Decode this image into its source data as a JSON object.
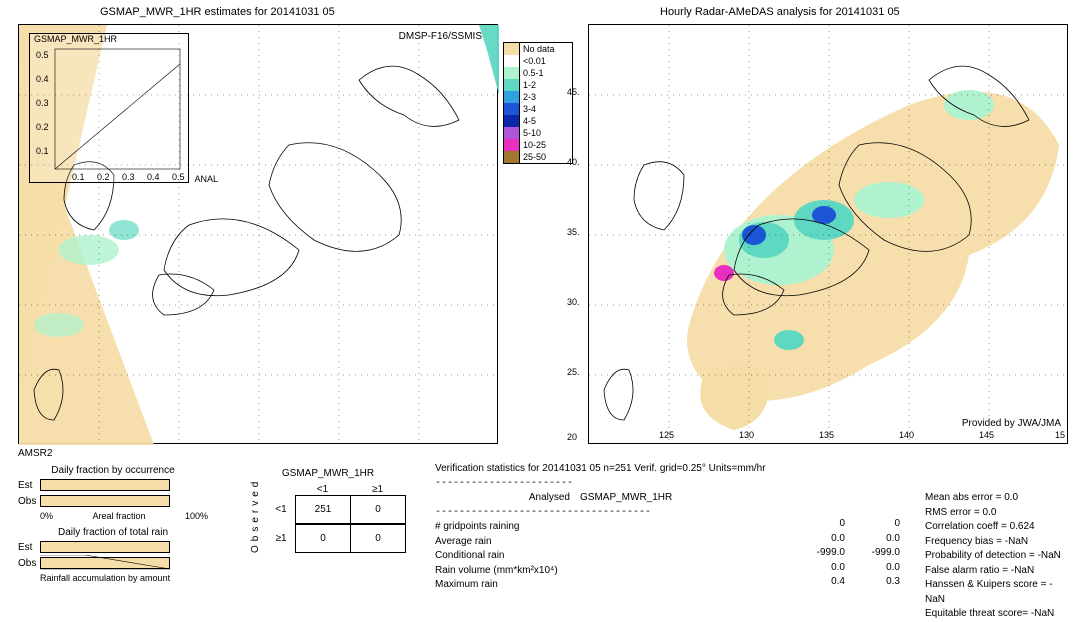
{
  "chart_data": [
    {
      "type": "map",
      "title": "GSMAP_MWR_1HR estimates for 20141031 05",
      "xlim": [
        120,
        150
      ],
      "ylim": [
        20,
        50
      ],
      "overlays": [
        "AMSR2",
        "DMSP-F16/SSMIS"
      ],
      "legend": [
        {
          "label": "No data",
          "color": "#f5dda8"
        },
        {
          "label": "<0.01",
          "color": "#ffffff"
        },
        {
          "label": "0.5-1",
          "color": "#aef2d0"
        },
        {
          "label": "1-2",
          "color": "#5fd8c2"
        },
        {
          "label": "2-3",
          "color": "#2fa0e0"
        },
        {
          "label": "3-4",
          "color": "#1c56d6"
        },
        {
          "label": "4-5",
          "color": "#0a28a8"
        },
        {
          "label": "5-10",
          "color": "#b055d8"
        },
        {
          "label": "10-25",
          "color": "#e82fc0"
        },
        {
          "label": "25-50",
          "color": "#a07830"
        }
      ],
      "inset": {
        "label": "GSMAP_MWR_1HR",
        "xlim": [
          0.0,
          0.5
        ],
        "ylim": [
          0.0,
          0.5
        ],
        "xticks": [
          0.1,
          0.2,
          0.3,
          0.4,
          0.5
        ],
        "yticks": [
          0.1,
          0.2,
          0.3,
          0.4,
          0.5
        ],
        "diag_label": "ANAL"
      }
    },
    {
      "type": "map",
      "title": "Hourly Radar-AMeDAS analysis for 20141031 05",
      "xlim": [
        120,
        150
      ],
      "ylim": [
        20,
        50
      ],
      "xticks": [
        125,
        130,
        135,
        140,
        145
      ],
      "yticks": [
        25,
        30,
        35,
        40,
        45
      ],
      "provider": "Provided by JWA/JMA"
    },
    {
      "type": "bar",
      "title": "Daily fraction by occurrence",
      "categories": [
        "Est",
        "Obs"
      ],
      "values": [
        100,
        100
      ],
      "xlabel": "Areal fraction",
      "xlim": [
        0,
        100
      ],
      "unit": "%"
    },
    {
      "type": "bar",
      "title": "Daily fraction of total rain",
      "categories": [
        "Est",
        "Obs"
      ],
      "values": [
        100,
        100
      ],
      "caption": "Rainfall accumulation by amount"
    },
    {
      "type": "table",
      "title": "GSMAP_MWR_1HR",
      "col_labels": [
        "<1",
        "≥1"
      ],
      "row_labels": [
        "<1",
        "≥1"
      ],
      "row_axis": "Observed",
      "cells": [
        [
          251,
          0
        ],
        [
          0,
          0
        ]
      ]
    }
  ],
  "left": {
    "title": "GSMAP_MWR_1HR estimates for 20141031 05",
    "inset_label": "GSMAP_MWR_1HR",
    "anal": "ANAL",
    "amsr2": "AMSR2",
    "dmsp": "DMSP-F16/SSMIS"
  },
  "right": {
    "title": "Hourly Radar-AMeDAS analysis for 20141031 05",
    "provider": "Provided by JWA/JMA",
    "xticks": [
      "125",
      "130",
      "135",
      "140",
      "145"
    ],
    "yticks": [
      "25.",
      "30.",
      "35.",
      "40.",
      "45."
    ]
  },
  "legend": {
    "items": [
      {
        "label": "No data",
        "color": "#f5dda8"
      },
      {
        "label": "<0.01",
        "color": "#ffffff"
      },
      {
        "label": "0.5-1",
        "color": "#aef2d0"
      },
      {
        "label": "1-2",
        "color": "#5fd8c2"
      },
      {
        "label": "2-3",
        "color": "#2fa0e0"
      },
      {
        "label": "3-4",
        "color": "#1c56d6"
      },
      {
        "label": "4-5",
        "color": "#0a28a8"
      },
      {
        "label": "5-10",
        "color": "#b055d8"
      },
      {
        "label": "10-25",
        "color": "#e82fc0"
      },
      {
        "label": "25-50",
        "color": "#a07830"
      }
    ]
  },
  "verif": {
    "header": "Verification statistics for 20141031 05  n=251  Verif. grid=0.25°  Units=mm/hr",
    "col_analysed": "Analysed",
    "col_est": "GSMAP_MWR_1HR",
    "rows": [
      {
        "label": "# gridpoints raining",
        "a": "0",
        "b": "0"
      },
      {
        "label": "Average rain",
        "a": "0.0",
        "b": "0.0"
      },
      {
        "label": "Conditional rain",
        "a": "-999.0",
        "b": "-999.0"
      },
      {
        "label": "Rain volume (mm*km²x10⁴)",
        "a": "0.0",
        "b": "0.0"
      },
      {
        "label": "Maximum rain",
        "a": "0.4",
        "b": "0.3"
      }
    ],
    "metrics": [
      "Mean abs error = 0.0",
      "RMS error = 0.0",
      "Correlation coeff = 0.624",
      "Frequency bias = -NaN",
      "Probability of detection = -NaN",
      "False alarm ratio = -NaN",
      "Hanssen & Kuipers score = -NaN",
      "Equitable threat score= -NaN"
    ]
  },
  "bars": {
    "occ_title": "Daily fraction by occurrence",
    "occ_est": "Est",
    "occ_obs": "Obs",
    "areal_0": "0%",
    "areal_lbl": "Areal fraction",
    "areal_100": "100%",
    "tot_title": "Daily fraction of total rain",
    "tot_caption": "Rainfall accumulation by amount"
  },
  "ct": {
    "title": "GSMAP_MWR_1HR",
    "lt1": "<1",
    "ge1": "≥1",
    "observed": "Observed",
    "c00": "251",
    "c01": "0",
    "c10": "0",
    "c11": "0"
  },
  "inset_ticks": {
    "x": [
      "0.1",
      "0.2",
      "0.3",
      "0.4",
      "0.5"
    ]
  }
}
